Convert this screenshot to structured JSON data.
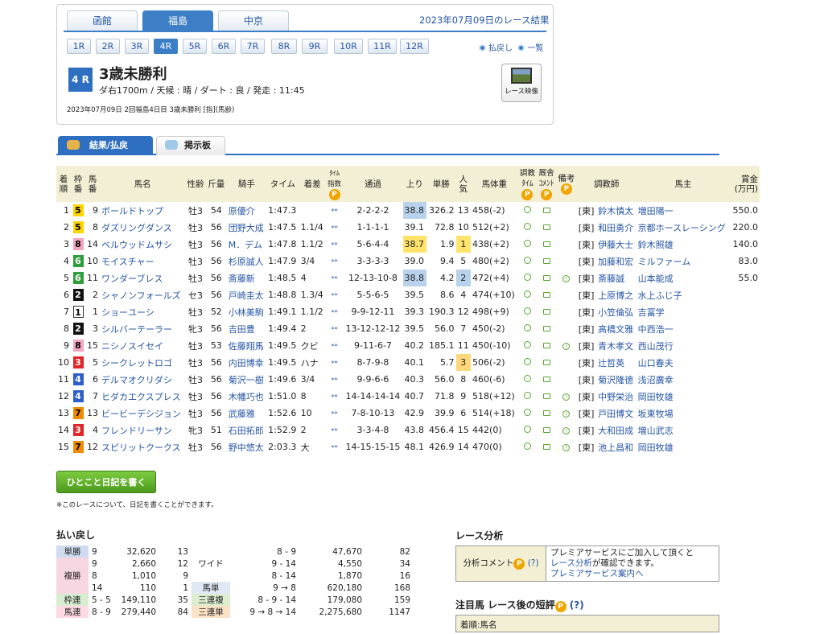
{
  "venues": [
    "函館",
    "福島",
    "中京"
  ],
  "active_venue": 1,
  "race_date_title": "2023年07月09日のレース結果",
  "race_buttons": [
    "1R",
    "2R",
    "3R",
    "4R",
    "5R",
    "6R",
    "7R",
    "8R",
    "9R",
    "10R",
    "11R",
    "12R"
  ],
  "active_race": 3,
  "nav": {
    "back": "払戻し",
    "list": "一覧"
  },
  "race": {
    "num": "4 R",
    "title": "3歳未勝利",
    "cond": "ダ右1700m / 天候 : 晴 / ダート : 良 / 発走 : 11:45",
    "meta": "2023年07月09日 2回福島4日目 3歳未勝利 [指](馬齢)",
    "video": "レース映像"
  },
  "tabs": [
    "結果/払戻",
    "掲示板"
  ],
  "headers": {
    "rank": "着\n順",
    "waku": "枠\n番",
    "uma": "馬\n番",
    "name": "馬名",
    "sexage": "性齢",
    "weight": "斤量",
    "jockey": "騎手",
    "time": "タイム",
    "diff": "着差",
    "tindex": "ﾀｲﾑ\n指数",
    "pass": "通過",
    "last": "上り",
    "odds": "単勝",
    "pop": "人\n気",
    "bw": "馬体重",
    "chokyo": "調教\nﾀｲﾑ",
    "kyusha": "厩舎\nｺﾒﾝﾄ",
    "biko": "備考",
    "trainer": "調教師",
    "owner": "馬主",
    "prize": "賞金\n(万円)"
  },
  "p_mark": "P",
  "rows": [
    [
      "1",
      "5",
      "9",
      "ボールドトップ",
      "牡3",
      "54",
      "原優介",
      "1:47.3",
      "",
      "**",
      "2-2-2-2",
      "38.8",
      "326.2",
      "13",
      "458(-2)",
      "",
      "[東]",
      "鈴木慎太",
      "増田陽一",
      "550.0"
    ],
    [
      "2",
      "5",
      "8",
      "ダズリングダンス",
      "牡3",
      "56",
      "団野大成",
      "1:47.5",
      "1.1/4",
      "**",
      "1-1-1-1",
      "39.1",
      "72.8",
      "10",
      "512(+2)",
      "",
      "[東]",
      "和田勇介",
      "京都ホースレーシング",
      "220.0"
    ],
    [
      "3",
      "8",
      "14",
      "ベルウッドムサシ",
      "牡3",
      "56",
      "M．デム",
      "1:47.8",
      "1.1/2",
      "**",
      "5-6-4-4",
      "38.7",
      "1.9",
      "1",
      "438(+2)",
      "",
      "[東]",
      "伊藤大士",
      "鈴木照雄",
      "140.0"
    ],
    [
      "4",
      "6",
      "10",
      "モイスチャー",
      "牡3",
      "56",
      "杉原誠人",
      "1:47.9",
      "3/4",
      "**",
      "3-3-3-3",
      "39.0",
      "9.4",
      "5",
      "480(+2)",
      "",
      "[東]",
      "加藤和宏",
      "ミルファーム",
      "83.0"
    ],
    [
      "5",
      "6",
      "11",
      "ワンダーブレス",
      "牡3",
      "56",
      "斎藤新",
      "1:48.5",
      "4",
      "**",
      "12-13-10-8",
      "38.8",
      "4.2",
      "2",
      "472(+4)",
      "1",
      "[東]",
      "斎藤誠",
      "山本能成",
      "55.0"
    ],
    [
      "6",
      "2",
      "2",
      "シャノンフォールズ",
      "セ3",
      "56",
      "戸崎圭太",
      "1:48.8",
      "1.3/4",
      "**",
      "5-5-6-5",
      "39.5",
      "8.6",
      "4",
      "474(+10)",
      "",
      "[東]",
      "上原博之",
      "水上ふじ子",
      ""
    ],
    [
      "7",
      "1",
      "1",
      "ショーユーシ",
      "牡3",
      "52",
      "小林美駒",
      "1:49.1",
      "1.1/2",
      "**",
      "9-9-12-11",
      "39.3",
      "190.3",
      "12",
      "498(+9)",
      "",
      "[東]",
      "小笠倫弘",
      "吉冨学",
      ""
    ],
    [
      "8",
      "2",
      "3",
      "シルバーテーラー",
      "牝3",
      "56",
      "吉田豊",
      "1:49.4",
      "2",
      "**",
      "13-12-12-12",
      "39.5",
      "56.0",
      "7",
      "450(-2)",
      "",
      "[東]",
      "高橋文雅",
      "中西浩一",
      ""
    ],
    [
      "9",
      "8",
      "15",
      "ニシノスイセイ",
      "牡3",
      "53",
      "佐藤翔馬",
      "1:49.5",
      "クビ",
      "**",
      "9-11-6-7",
      "40.2",
      "185.1",
      "11",
      "450(-10)",
      "1",
      "[東]",
      "青木孝文",
      "西山茂行",
      ""
    ],
    [
      "10",
      "3",
      "5",
      "シークレットロゴ",
      "牡3",
      "56",
      "内田博幸",
      "1:49.5",
      "ハナ",
      "**",
      "8-7-9-8",
      "40.1",
      "5.7",
      "3",
      "506(-2)",
      "",
      "[東]",
      "辻哲英",
      "山口春夫",
      ""
    ],
    [
      "11",
      "4",
      "6",
      "デルマオクリダシ",
      "牡3",
      "56",
      "菊沢一樹",
      "1:49.6",
      "3/4",
      "**",
      "9-9-6-6",
      "40.3",
      "56.0",
      "8",
      "460(-6)",
      "",
      "[東]",
      "菊沢隆徳",
      "浅沼廣幸",
      ""
    ],
    [
      "12",
      "4",
      "7",
      "ヒダカエクスプレス",
      "牡3",
      "56",
      "木幡巧也",
      "1:51.0",
      "8",
      "**",
      "14-14-14-14",
      "40.7",
      "71.8",
      "9",
      "518(+12)",
      "1",
      "[東]",
      "中野栄治",
      "岡田牧雄",
      ""
    ],
    [
      "13",
      "7",
      "13",
      "ビービーデシジョン",
      "牡3",
      "56",
      "武藤雅",
      "1:52.6",
      "10",
      "**",
      "7-8-10-13",
      "42.9",
      "39.9",
      "6",
      "514(+18)",
      "1",
      "[東]",
      "戸田博文",
      "坂東牧場",
      ""
    ],
    [
      "14",
      "3",
      "4",
      "フレンドリーサン",
      "牝3",
      "51",
      "石田拓郎",
      "1:52.9",
      "2",
      "**",
      "3-3-4-8",
      "43.8",
      "456.4",
      "15",
      "442(0)",
      "1",
      "[東]",
      "大和田成",
      "増山武志",
      ""
    ],
    [
      "15",
      "7",
      "12",
      "スピリットクークス",
      "牡3",
      "56",
      "野中悠太",
      "2:03.3",
      "大",
      "**",
      "14-15-15-15",
      "48.1",
      "426.9",
      "14",
      "470(0)",
      "1",
      "[東]",
      "池上昌和",
      "岡田牧雄",
      ""
    ]
  ],
  "diary": {
    "button": "ひとこと日記を書く",
    "note": "※このレースについて、日記を書くことができます。"
  },
  "payout": {
    "title": "払い戻し",
    "tansho": {
      "label": "単勝",
      "num": "9",
      "pay": "32,620",
      "pop": "13"
    },
    "fukusho": {
      "label": "複勝",
      "rows": [
        [
          "9",
          "2,660",
          "12"
        ],
        [
          "8",
          "1,010",
          "9"
        ],
        [
          "14",
          "110",
          "1"
        ]
      ]
    },
    "wakuren": {
      "label": "枠連",
      "num": "5 - 5",
      "pay": "149,110",
      "pop": "35"
    },
    "umaren": {
      "label": "馬連",
      "num": "8 - 9",
      "pay": "279,440",
      "pop": "84"
    },
    "wide": {
      "label": "ワイド",
      "rows": [
        [
          "8 - 9",
          "47,670",
          "82"
        ],
        [
          "9 - 14",
          "4,550",
          "34"
        ],
        [
          "8 - 14",
          "1,870",
          "16"
        ]
      ]
    },
    "umatan": {
      "label": "馬単",
      "num": "9 → 8",
      "pay": "620,180",
      "pop": "168"
    },
    "sanrenpuku": {
      "label": "三連複",
      "num": "8 - 9 - 14",
      "pay": "179,080",
      "pop": "159"
    },
    "sanrentan": {
      "label": "三連単",
      "num": "9 → 8 → 14",
      "pay": "2,275,680",
      "pop": "1147"
    }
  },
  "analysis": {
    "title": "レース分析",
    "label": "分析コメント",
    "help": "(?)",
    "line1": "プレミアサービスにご加入して頂くと",
    "link1": "レース分析",
    "line2": "が確認できます。",
    "link2": "プレミアサービス案内へ"
  },
  "chuumoku": {
    "title": "注目馬 レース後の短評",
    "help": "(?)",
    "col": "着順:馬名"
  }
}
